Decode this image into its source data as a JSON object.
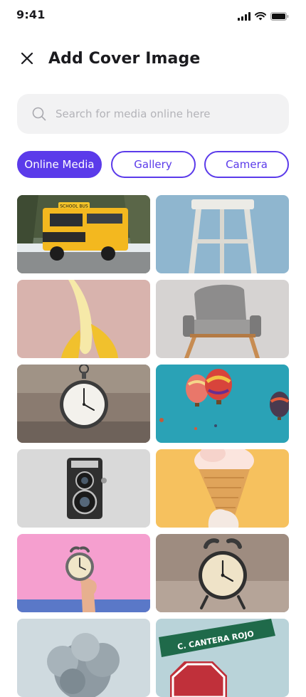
{
  "status_bar": {
    "time": "9:41"
  },
  "header": {
    "title": "Add Cover Image"
  },
  "search": {
    "placeholder": "Search for media online here"
  },
  "tabs": [
    {
      "label": "Online Media",
      "active": true
    },
    {
      "label": "Gallery",
      "active": false
    },
    {
      "label": "Camera",
      "active": false
    }
  ],
  "colors": {
    "accent": "#5b3bea",
    "search_bg": "#f2f2f3"
  },
  "media_grid": [
    {
      "subject": "school-bus",
      "label": "SCHOOL BUS"
    },
    {
      "subject": "wooden-stool"
    },
    {
      "subject": "banana"
    },
    {
      "subject": "gray-armchair"
    },
    {
      "subject": "pocket-watch"
    },
    {
      "subject": "hot-air-balloons"
    },
    {
      "subject": "vintage-camera"
    },
    {
      "subject": "ice-cream-cone"
    },
    {
      "subject": "alarm-clock-in-hand"
    },
    {
      "subject": "alarm-clock"
    },
    {
      "subject": "smoke-cloud"
    },
    {
      "subject": "street-sign",
      "label": "C. CANTERA ROJO"
    }
  ]
}
